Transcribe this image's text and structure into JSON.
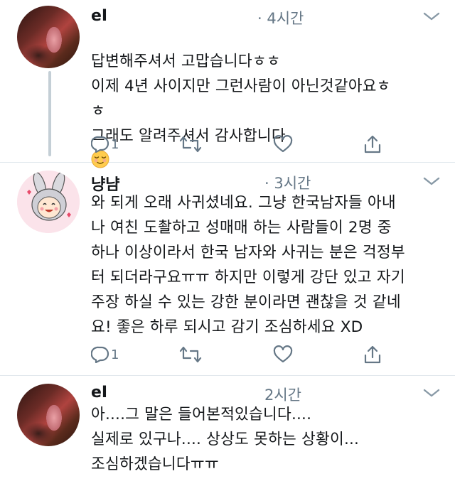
{
  "tweets": [
    {
      "name": "eI",
      "time": "· 4시간",
      "text": "답변해주셔서 고맙습니다ㅎㅎ\n이제 4년 사이지만 그런사람이 아닌것같아요ㅎ\nㅎ\n그래도 알려주셔서 감사합니다",
      "reply_count": "1",
      "emoji": "relieved-face"
    },
    {
      "name": "냥냠",
      "time": "· 3시간",
      "text": "와 되게 오래 사귀셨네요. 그냥 한국남자들 아내\n나 여친 도촬하고 성매매 하는 사람들이 2명 중\n하나 이상이라서 한국 남자와 사귀는 분은 걱정부\n터 되더라구요ㅠㅠ 하지만 이렇게 강단 있고 자기\n주장 하실 수 있는 강한 분이라면 괜찮을 것 같네\n요! 좋은 하루 되시고 감기 조심하세요 XD",
      "reply_count": "1"
    },
    {
      "name": "eI",
      "time": "2시간",
      "text": "아....그 말은 들어본적있습니다....\n실제로 있구나.... 상상도 못하는 상황이...\n조심하겠습니다ㅠㅠ"
    }
  ],
  "icons": [
    "reply-icon",
    "retweet-icon",
    "like-icon",
    "share-icon",
    "chevron-down-icon"
  ],
  "colors": {
    "text": "#14171a",
    "muted": "#657786",
    "thread": "#c4cfd6"
  }
}
